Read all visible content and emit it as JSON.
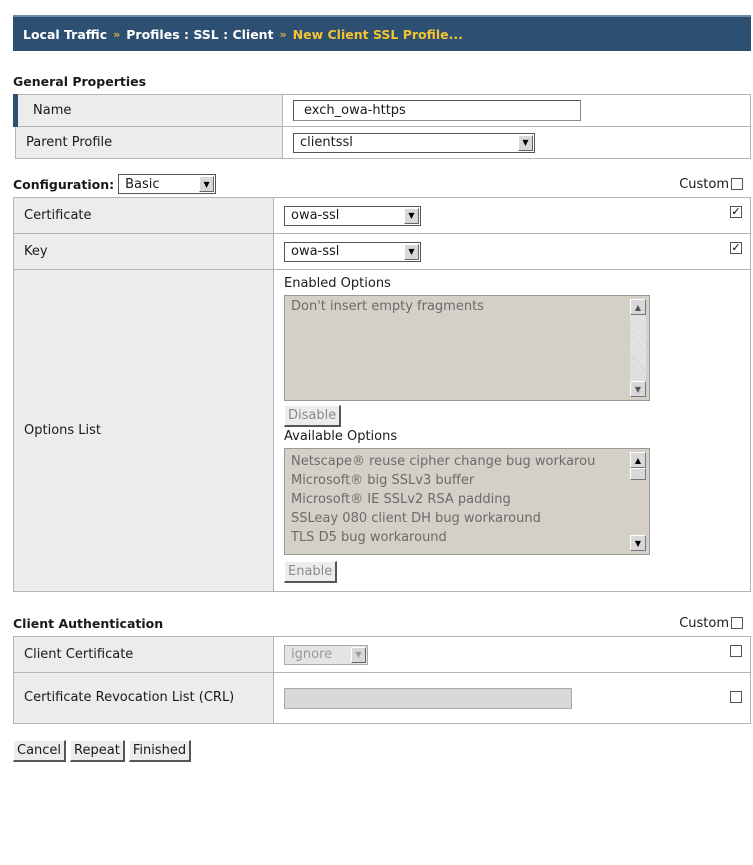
{
  "breadcrumb": {
    "part1": "Local Traffic",
    "part2": "Profiles : SSL : Client",
    "current": "New Client SSL Profile...",
    "separator": "»"
  },
  "general": {
    "heading": "General Properties",
    "name_label": "Name",
    "name_value": "exch_owa-https",
    "parent_label": "Parent Profile",
    "parent_value": "clientssl"
  },
  "configuration": {
    "heading": "Configuration:",
    "mode_value": "Basic",
    "custom_label": "Custom",
    "certificate_label": "Certificate",
    "certificate_value": "owa-ssl",
    "certificate_custom": true,
    "key_label": "Key",
    "key_value": "owa-ssl",
    "key_custom": true,
    "options_label": "Options List",
    "enabled_heading": "Enabled Options",
    "enabled_items": [
      "Don't insert empty fragments"
    ],
    "disable_button": "Disable",
    "available_heading": "Available Options",
    "available_items": [
      "Netscape® reuse cipher change bug workarou",
      "Microsoft® big SSLv3 buffer",
      "Microsoft® IE SSLv2 RSA padding",
      "SSLeay 080 client DH bug workaround",
      "TLS D5 bug workaround"
    ],
    "enable_button": "Enable"
  },
  "client_auth": {
    "heading": "Client Authentication",
    "custom_label": "Custom",
    "client_cert_label": "Client Certificate",
    "client_cert_value": "ignore",
    "crl_label": "Certificate Revocation List (CRL)",
    "crl_value": ""
  },
  "footer": {
    "cancel": "Cancel",
    "repeat": "Repeat",
    "finished": "Finished"
  },
  "icons": {
    "dropdown": "chevron-down-icon",
    "check": "checkmark-icon"
  },
  "colors": {
    "header_bg": "#2c4f72",
    "breadcrumb_current": "#f3c430",
    "label_bg": "#ececec"
  }
}
